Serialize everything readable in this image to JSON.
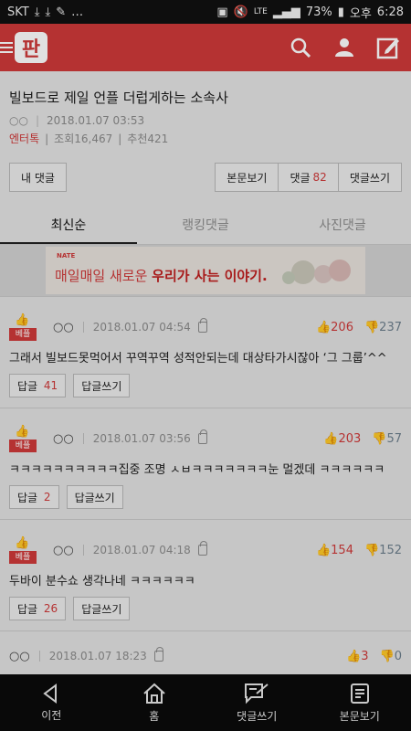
{
  "status": {
    "carrier": "SKT",
    "battery": "73%",
    "ampm": "오후",
    "time": "6:28"
  },
  "header": {
    "logo_text": "판",
    "icons": [
      "search-icon",
      "user-icon",
      "write-icon"
    ]
  },
  "article": {
    "title": "빌보드로 제일 언플 더럽게하는 소속사",
    "author": "○○",
    "date": "2018.01.07 03:53",
    "category": "엔터톡",
    "views_label": "조회16,467",
    "recommend_label": "추천421"
  },
  "buttons": {
    "my_comments": "내 댓글",
    "view_body": "본문보기",
    "comments": "댓글",
    "comments_count": "82",
    "write_comment": "댓글쓰기"
  },
  "tabs": [
    {
      "label": "최신순"
    },
    {
      "label": "랭킹댓글"
    },
    {
      "label": "사진댓글"
    }
  ],
  "banner": {
    "brand": "NATE",
    "text_pre": "매일매일 새로운 ",
    "text_bold": "우리가 사는 이야기."
  },
  "comments": [
    {
      "badge": "베플",
      "nick": "○○",
      "date": "2018.01.07 04:54",
      "up": "206",
      "down": "237",
      "body": "그래서 빌보드못먹어서 꾸역꾸역 성적안되는데 대상타가시잖아 ‘그 그룹’^^",
      "reply_label": "답글",
      "reply_count": "41",
      "write_reply": "답글쓰기"
    },
    {
      "badge": "베플",
      "nick": "○○",
      "date": "2018.01.07 03:56",
      "up": "203",
      "down": "57",
      "body": "ㅋㅋㅋㅋㅋㅋㅋㅋㅋㅋ집중 조명 ㅅㅂㅋㅋㅋㅋㅋㅋㅋ눈 멀겠데 ㅋㅋㅋㅋㅋㅋ",
      "reply_label": "답글",
      "reply_count": "2",
      "write_reply": "답글쓰기"
    },
    {
      "badge": "베플",
      "nick": "○○",
      "date": "2018.01.07 04:18",
      "up": "154",
      "down": "152",
      "body": "두바이 분수쇼 생각나네 ㅋㅋㅋㅋㅋㅋ",
      "reply_label": "답글",
      "reply_count": "26",
      "write_reply": "답글쓰기"
    },
    {
      "nick": "○○",
      "date": "2018.01.07 18:23",
      "up": "3",
      "down": "0"
    }
  ],
  "bottom_nav": [
    {
      "label": "이전",
      "icon": "back-icon"
    },
    {
      "label": "홈",
      "icon": "home-icon"
    },
    {
      "label": "댓글쓰기",
      "icon": "comment-write-icon"
    },
    {
      "label": "본문보기",
      "icon": "article-icon"
    }
  ]
}
